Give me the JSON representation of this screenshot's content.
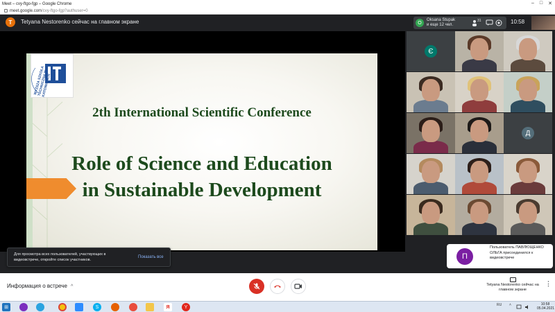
{
  "browser": {
    "title": "Meet – cvy-ftgo-fgp – Google Chrome",
    "url_host": "meet.google.com",
    "url_path": "/cvy-ftgo-fgp?authuser=0",
    "window_controls": [
      "–",
      "□",
      "✕"
    ]
  },
  "meet": {
    "presenter_initial": "T",
    "presenter_text": "Tetyana Nestorenko сейчас на главном экране",
    "pinned_initial": "O",
    "pinned_name": "Oksana Stupak",
    "pinned_more": "и еще 12 чел.",
    "pinned_count": "31",
    "time": "10:58"
  },
  "slide": {
    "logo_text": "WYŻSZA SZKOŁA TECHNICZNA W KATOWICACH",
    "logo_mark": "WST",
    "conference": "2th International Scientific Conference",
    "title_line1": "Role of Science and Education",
    "title_line2": "in Sustainable Development"
  },
  "participants": [
    {
      "type": "letter",
      "letter": "Є",
      "bg": "#00796b"
    },
    {
      "type": "face",
      "hair": "#5b3a29",
      "body": "#3a3a46",
      "bg": "#b9b3a6"
    },
    {
      "type": "face",
      "hair": "#d8d8d8",
      "body": "#5c4b3e",
      "bg": "#cfcac0"
    },
    {
      "type": "face",
      "hair": "#3b2b22",
      "body": "#6b7c8f",
      "bg": "#c9c2b4"
    },
    {
      "type": "face",
      "hair": "#e0c27a",
      "body": "#8f3d3d",
      "bg": "#d8d2c7"
    },
    {
      "type": "face",
      "hair": "#c9a35a",
      "body": "#2f4e5f",
      "bg": "#c4cfc8"
    },
    {
      "type": "face",
      "hair": "#2b1d18",
      "body": "#7a2b4a",
      "bg": "#7a7266"
    },
    {
      "type": "face",
      "hair": "#1e1a18",
      "body": "#2a2f3a",
      "bg": "#a89d8c"
    },
    {
      "type": "letter",
      "letter": "Д",
      "bg": "#546e7a"
    },
    {
      "type": "face",
      "hair": "#b48a5e",
      "body": "#4c5c6e",
      "bg": "#d6d3cc"
    },
    {
      "type": "face",
      "hair": "#2d1f1a",
      "body": "#b04a3a",
      "bg": "#b9c1c8"
    },
    {
      "type": "face",
      "hair": "#8a5a3a",
      "body": "#6a3b3b",
      "bg": "#d9d4ca"
    },
    {
      "type": "face",
      "hair": "#3a2a1e",
      "body": "#3f4f3f",
      "bg": "#c7b59a"
    },
    {
      "type": "face",
      "hair": "#6b4a32",
      "body": "#2e3440",
      "bg": "#b3ac9f"
    },
    {
      "type": "face",
      "hair": "#4a3b30",
      "body": "#5a5a5a",
      "bg": "#cfc7b8"
    }
  ],
  "toast": {
    "message": "Для просмотра всех пользователей, участвующих в видеовстрече, откройте список участников.",
    "action": "Показать все"
  },
  "join": {
    "initial": "П",
    "text": "Пользователь ПАВЛЮЩЕНКО ОЛЬГА присоединился к видеовстрече"
  },
  "controls": {
    "info_label": "Информация о встрече",
    "present_label": "Tetyana Nestorenko сейчас на главном экране",
    "more": "⋮"
  },
  "taskbar": {
    "lang": "RU",
    "time": "10:58",
    "date": "05.04.2021"
  }
}
